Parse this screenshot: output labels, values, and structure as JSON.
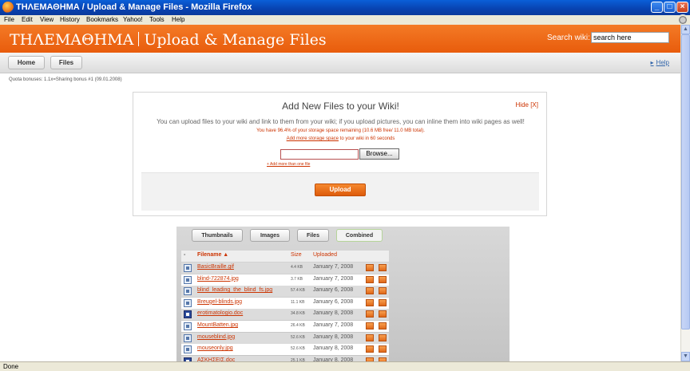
{
  "window": {
    "title": "ΤΗΛΕΜΑΘΗΜΑ / Upload & Manage Files - Mozilla Firefox",
    "minimize_glyph": "_",
    "maximize_glyph": "□",
    "close_glyph": "×"
  },
  "menubar": {
    "items": [
      "File",
      "Edit",
      "View",
      "History",
      "Bookmarks",
      "Yahoo!",
      "Tools",
      "Help"
    ]
  },
  "header": {
    "brand": "ΤΗΛΕΜΑΘΗΜΑ",
    "page_title": "Upload & Manage Files",
    "search_label": "Search wiki:",
    "search_value": "search here"
  },
  "nav": {
    "tabs": [
      "Home",
      "Files"
    ],
    "help": "Help"
  },
  "quota": "Quota bonuses: 1.1x=Sharing bonus #1 (09.01.2008)",
  "upload": {
    "title": "Add New Files to your Wiki!",
    "hide": "Hide [X]",
    "description": "You can upload files to your wiki and link to them from your wiki; if you upload pictures, you can inline them into wiki pages as well!",
    "storage": "You have 96.4% of your storage space remaining (10.6 MB free/ 11.0 MB total).",
    "more_storage_link": "Add more storage space",
    "more_storage_rest": " to your wiki in 60 seconds",
    "browse": "Browse...",
    "add_more": "+ Add more than one file",
    "upload_button": "Upload"
  },
  "files": {
    "view_tabs": [
      "Thumbnails",
      "Images",
      "Files",
      "Combined"
    ],
    "active_tab": "Combined",
    "columns": {
      "select": "-",
      "filename": "Filename ▲",
      "size": "Size",
      "uploaded": "Uploaded"
    },
    "rows": [
      {
        "name": "BasicBraille.gif",
        "size": "4.4 KB",
        "date": "January 7, 2008",
        "type": "image"
      },
      {
        "name": "blind-722874.jpg",
        "size": "3.7 KB",
        "date": "January 7, 2008",
        "type": "image"
      },
      {
        "name": "blind_leading_the_blind_fs.jpg",
        "size": "57.4 KB",
        "date": "January 6, 2008",
        "type": "image"
      },
      {
        "name": "Breugel-blinds.jpg",
        "size": "11.1 KB",
        "date": "January 6, 2008",
        "type": "image"
      },
      {
        "name": "erotimatologio.doc",
        "size": "34.8 KB",
        "date": "January 8, 2008",
        "type": "doc"
      },
      {
        "name": "MountBatten.jpg",
        "size": "26.4 KB",
        "date": "January 7, 2008",
        "type": "image"
      },
      {
        "name": "mouseblind.jpg",
        "size": "52.6 KB",
        "date": "January 8, 2008",
        "type": "image"
      },
      {
        "name": "mouseonly.jpg",
        "size": "52.6 KB",
        "date": "January 8, 2008",
        "type": "image"
      },
      {
        "name": "ΑΣΚΗΣΕΙΣ.doc",
        "size": "25.1 KB",
        "date": "January 8, 2008",
        "type": "doc"
      }
    ]
  },
  "status": "Done",
  "colors": {
    "brand_orange": "#e85c0c",
    "link_red": "#cc3300",
    "xp_blue": "#0842b0"
  }
}
